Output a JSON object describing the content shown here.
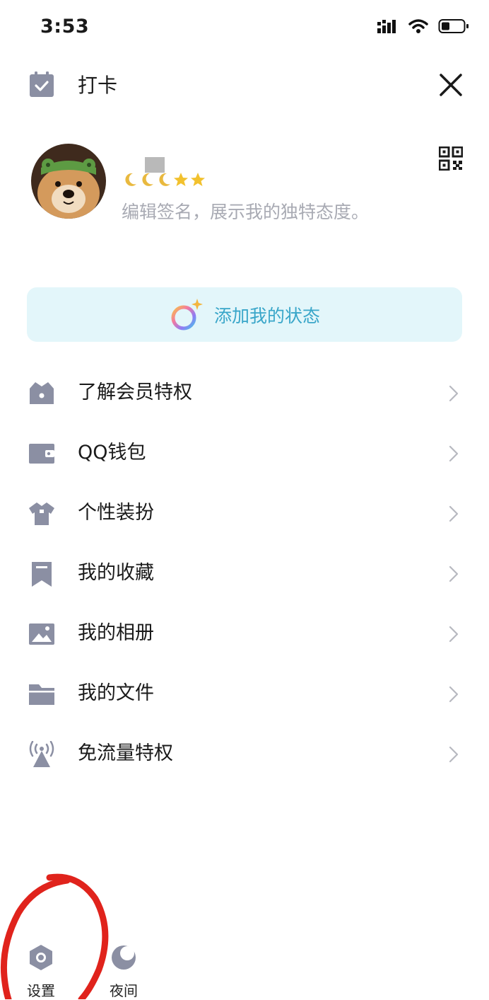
{
  "status_bar": {
    "time": "3:53"
  },
  "header": {
    "title": "打卡"
  },
  "profile": {
    "signature": "编辑签名，展示我的独特态度。"
  },
  "status_pill": {
    "label": "添加我的状态"
  },
  "menu": {
    "items": [
      {
        "label": "了解会员特权",
        "icon": "crown-bag-icon"
      },
      {
        "label": "QQ钱包",
        "icon": "wallet-icon"
      },
      {
        "label": "个性装扮",
        "icon": "shirt-icon"
      },
      {
        "label": "我的收藏",
        "icon": "bookmark-icon"
      },
      {
        "label": "我的相册",
        "icon": "photo-icon"
      },
      {
        "label": "我的文件",
        "icon": "folder-icon"
      },
      {
        "label": "免流量特权",
        "icon": "signal-tower-icon"
      }
    ]
  },
  "bottom_bar": {
    "settings_label": "设置",
    "night_label": "夜间"
  },
  "colors": {
    "icon_gray": "#8b8fa3",
    "pill_bg": "#e3f6fa",
    "pill_text": "#39a6c9",
    "annotation_red": "#e0231c"
  }
}
